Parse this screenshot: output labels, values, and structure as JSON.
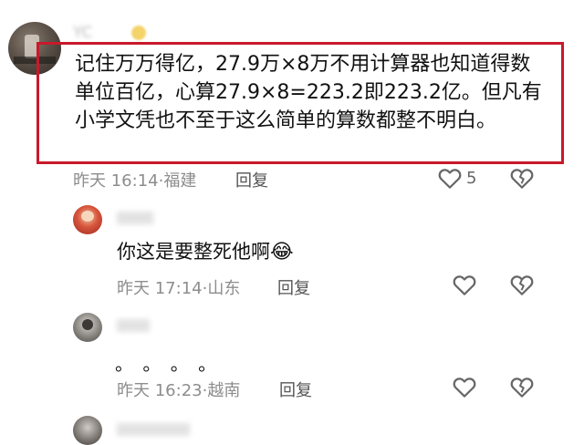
{
  "comments": [
    {
      "name": "YC",
      "text": "记住万万得亿，27.9万×8万不用计算器也知道得数单位百亿，心算27.9×8=223.2即223.2亿。但凡有小学文凭也不至于这么简单的算数都整不明白。",
      "time": "昨天 16:14",
      "sep": "·",
      "location": "福建",
      "reply_label": "回复",
      "like_count": "5",
      "like_icon": "heart-outline",
      "dislike_icon": "broken-heart-outline"
    },
    {
      "name": "",
      "text": "你这是要整死他啊",
      "emoji": "😂",
      "time": "昨天 17:14",
      "sep": "·",
      "location": "山东",
      "reply_label": "回复",
      "like_icon": "heart-outline",
      "dislike_icon": "broken-heart-outline"
    },
    {
      "name": "",
      "text": "。 。 。 。",
      "time": "昨天 16:23",
      "sep": "·",
      "location": "越南",
      "reply_label": "回复",
      "like_icon": "heart-outline",
      "dislike_icon": "broken-heart-outline"
    },
    {
      "name": ""
    }
  ],
  "colors": {
    "highlight_border": "#c8192b",
    "meta_text": "#8d8d8d",
    "body_text": "#111111"
  }
}
